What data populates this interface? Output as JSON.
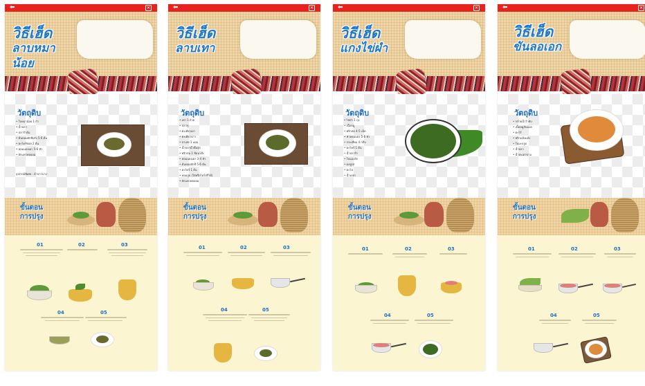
{
  "panels": [
    {
      "title_l1": "วิธีเฮ็ด",
      "title_l2": "ลาบหมาน้อย",
      "ingredients_title": "วัตถุดิบ",
      "ingredients": [
        "ใบหมาน้อย 1 กำ",
        "น้ำปลา",
        "ปลาร้าต้ม",
        "ต้นหอมผักชีฝรั่ง 5-6 ต้น",
        "ตะไคร้ซอย 2 ต้น",
        "หอมแดงเผา 5-6 หัว",
        "ผักแพวพลออม"
      ],
      "note": "อุปกรณ์พิเศษ : ผ้าขาวบาง",
      "steps_title_l1": "ขั้นตอน",
      "steps_title_l2": "การปรุง",
      "steps": [
        "01",
        "02",
        "03",
        "04",
        "05"
      ]
    },
    {
      "title_l1": "วิธีเฮ็ด",
      "title_l2": "ลาบเทา",
      "ingredients_title": "วัตถุดิบ",
      "ingredients": [
        "เทา 1 ถ้วย",
        "ปลาทู",
        "ตะเคียวเผา",
        "ตะเคียวขาว",
        "ปาเล่ย 1 แผ่ม",
        "น้ำปลาน้ำดั้มสุก",
        "พริกป่น 1 ช้อนโต๊ะ",
        "หอมแดงเผา 3-4 หัว",
        "ต้นหอมผักชี 5-6 ต้น",
        "ตะไคร้ 1 ต้น",
        "หอมสูบ (ใส่หรือไม่ใส่ก็ได้)",
        "ผักแพวพลออม"
      ],
      "steps_title_l1": "ขั้นตอน",
      "steps_title_l2": "การปรุง",
      "steps": [
        "01",
        "02",
        "03",
        "04",
        "05"
      ]
    },
    {
      "title_l1": "วิธีเฮ็ด",
      "title_l2": "แกงไข่ผำ",
      "ingredients_title": "วัตถุดิบ",
      "ingredients": [
        "ไข่ผำ 1 ถุง",
        "เนื้อหมู",
        "พริกสด 4-5 เม็ด",
        "หัวหอมแดง 5-6 หัว",
        "กระเทียม 4 กลีบ",
        "ตะไคร้ 1 ต้น",
        "น้ำปลาร้า",
        "ใบแมงลัก",
        "ผงชูรส",
        "ตะไป",
        "น้ำเปล่า"
      ],
      "steps_title_l1": "ขั้นตอน",
      "steps_title_l2": "การปรุง",
      "steps": [
        "01",
        "02",
        "03",
        "04",
        "05"
      ]
    },
    {
      "title_l1": "วิธีเฮ็ด",
      "title_l2": "ขันลอเอก",
      "ingredients_title": "วัตถุดิบ",
      "ingredients": [
        "กล้วยน้ำว้าดิบ",
        "เนื้อหมูสันนอก",
        "ตะไร้",
        "พริกแห้งแห้ง",
        "ใบมะกรูด",
        "น้ำปลา",
        "น้ำสะเดาขาม"
      ],
      "steps_title_l1": "ขั้นตอน",
      "steps_title_l2": "การปรุง",
      "steps": [
        "01",
        "02",
        "03",
        "04",
        "05"
      ]
    }
  ],
  "icons": {
    "back": "back-arrow-icon",
    "close": "close-icon"
  },
  "colors": {
    "topbar": "#e8231d",
    "title": "#1f78c8",
    "steps_bg": "#fbf5d2"
  }
}
